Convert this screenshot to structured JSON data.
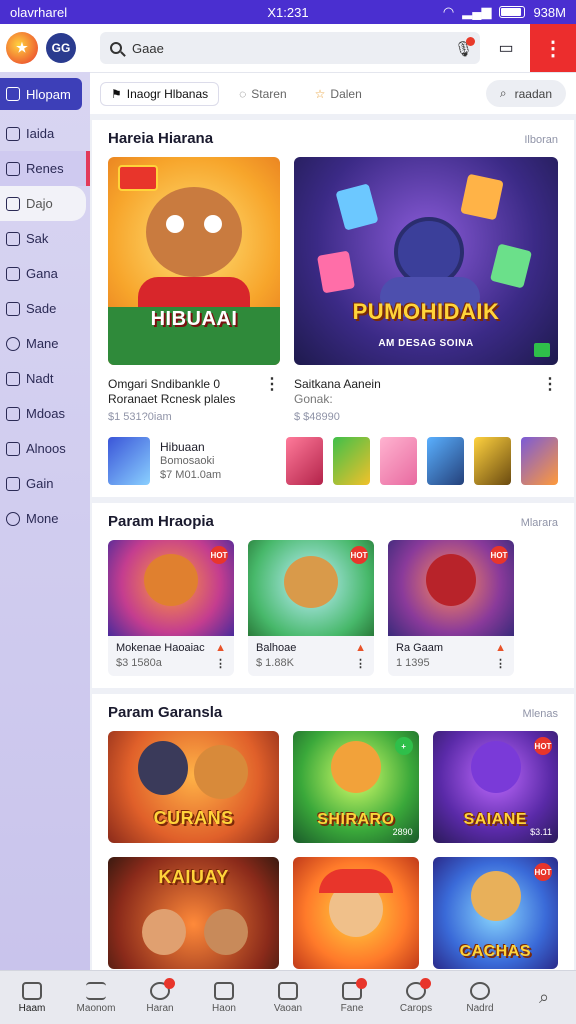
{
  "status_bar": {
    "carrier": "olavrharel",
    "time": "X1:231",
    "battery": "938M"
  },
  "colors": {
    "accent": "#3d3fb8",
    "status_bg": "#4a2fd0",
    "alert_red": "#ec2d2d"
  },
  "sidebar": {
    "items": [
      {
        "label": "Hlopam",
        "icon": "home-icon",
        "state": "active"
      },
      {
        "label": "Iaida",
        "icon": "grid-icon",
        "state": "normal"
      },
      {
        "label": "Renes",
        "icon": "list-icon",
        "state": "highlighted"
      },
      {
        "label": "Dajo",
        "icon": "tag-icon",
        "state": "selected"
      },
      {
        "label": "Sak",
        "icon": "folder-icon",
        "state": "normal"
      },
      {
        "label": "Gana",
        "icon": "chat-icon",
        "state": "normal"
      },
      {
        "label": "Sade",
        "icon": "box-icon",
        "state": "normal"
      },
      {
        "label": "Mane",
        "icon": "clock-icon",
        "state": "normal"
      },
      {
        "label": "Nadt",
        "icon": "shield-icon",
        "state": "normal"
      },
      {
        "label": "Mdoas",
        "icon": "doc-icon",
        "state": "normal"
      },
      {
        "label": "Alnoos",
        "icon": "calendar-icon",
        "state": "normal"
      },
      {
        "label": "Gain",
        "icon": "chart-icon",
        "state": "normal"
      },
      {
        "label": "Mone",
        "icon": "more-icon",
        "state": "normal"
      }
    ]
  },
  "search": {
    "value": "Gaae"
  },
  "tabs": [
    {
      "label": "Inaogr Hlbanas",
      "icon": "flag-icon",
      "active": true
    },
    {
      "label": "Staren",
      "icon": "leaf-icon",
      "active": false
    },
    {
      "label": "Dalen",
      "icon": "star-icon",
      "active": false
    }
  ],
  "tab_pill": {
    "label": "raadan"
  },
  "sections": {
    "featured": {
      "title": "Hareia Hiarana",
      "link": "Ilboran",
      "cards": [
        {
          "art_title": "HIBUAAI",
          "art_badge": "",
          "name": "Omgari Sndibankle 0",
          "name2": "Roranaet Rcnesk plales",
          "price": "$1 531?0iam"
        },
        {
          "art_title": "PUMOHIDAIK",
          "art_sub": "AM DESAG SOINA",
          "name": "Saitkana Aanein",
          "name2": "Gonak:",
          "price": "$ $48990"
        }
      ],
      "mini": {
        "title": "Hibuaan",
        "sub": "Bomosaoki",
        "price": "$7 M01.0am"
      }
    },
    "popular": {
      "title": "Param Hraopia",
      "link": "Mlarara",
      "cards": [
        {
          "name": "Mokenae Haoaiac",
          "price": "$3 1580a"
        },
        {
          "name": "Balhoae",
          "price": "$ 1.88K"
        },
        {
          "name": "Ra Gaam",
          "price": "1 1395"
        }
      ]
    },
    "games": {
      "title": "Param Garansla",
      "link": "Mlenas",
      "cards": [
        {
          "art_title": "CURANS",
          "corner": ""
        },
        {
          "art_title": "SHIRARO",
          "corner": "2890"
        },
        {
          "art_title": "SAIANE",
          "corner": "$3.11"
        },
        {
          "art_title": "KAIUAY",
          "corner": ""
        },
        {
          "art_title": "",
          "corner": ""
        },
        {
          "art_title": "CACHAS",
          "corner": ""
        }
      ]
    }
  },
  "bottom_nav": [
    {
      "label": "Haam",
      "icon": "home-icon",
      "badge": false
    },
    {
      "label": "Maonom",
      "icon": "menu-icon",
      "badge": false
    },
    {
      "label": "Haran",
      "icon": "bell-icon",
      "badge": true
    },
    {
      "label": "Haon",
      "icon": "note-icon",
      "badge": false
    },
    {
      "label": "Vaoan",
      "icon": "heart-icon",
      "badge": false
    },
    {
      "label": "Fane",
      "icon": "cart-icon",
      "badge": true
    },
    {
      "label": "Carops",
      "icon": "gift-icon",
      "badge": true
    },
    {
      "label": "Nadrd",
      "icon": "user-icon",
      "badge": false
    },
    {
      "label": "",
      "icon": "search-icon",
      "badge": false
    }
  ]
}
